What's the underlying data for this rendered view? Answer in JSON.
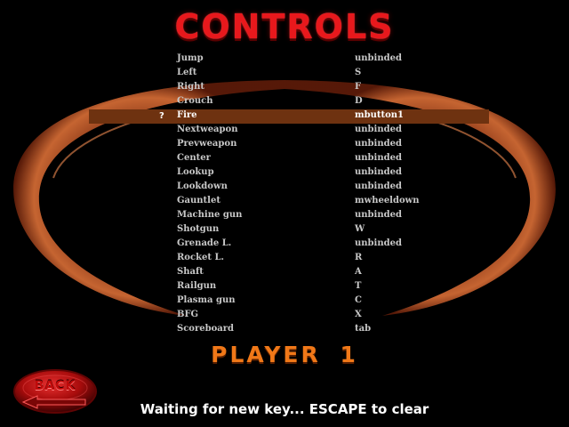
{
  "title": "CONTROLS",
  "bindings": [
    {
      "action": "Jump",
      "key": "unbinded"
    },
    {
      "action": "Left",
      "key": "S"
    },
    {
      "action": "Right",
      "key": "F"
    },
    {
      "action": "Crouch",
      "key": "D"
    },
    {
      "action": "Fire",
      "key": "mbutton1",
      "selected": true
    },
    {
      "action": "Nextweapon",
      "key": "unbinded"
    },
    {
      "action": "Prevweapon",
      "key": "unbinded"
    },
    {
      "action": "Center",
      "key": "unbinded"
    },
    {
      "action": "Lookup",
      "key": "unbinded"
    },
    {
      "action": "Lookdown",
      "key": "unbinded"
    },
    {
      "action": "Gauntlet",
      "key": "mwheeldown"
    },
    {
      "action": "Machine gun",
      "key": "unbinded"
    },
    {
      "action": "Shotgun",
      "key": "W"
    },
    {
      "action": "Grenade L.",
      "key": "unbinded"
    },
    {
      "action": "Rocket L.",
      "key": "R"
    },
    {
      "action": "Shaft",
      "key": "A"
    },
    {
      "action": "Railgun",
      "key": "T"
    },
    {
      "action": "Plasma gun",
      "key": "C"
    },
    {
      "action": "BFG",
      "key": "X"
    },
    {
      "action": "Scoreboard",
      "key": "tab"
    }
  ],
  "selection_marker": "?",
  "player_label": "PLAYER 1",
  "back_label": "BACK",
  "status_text": "Waiting for new key... ESCAPE to clear",
  "colors": {
    "title": "#e8181c",
    "player_label": "#f07818",
    "highlight": "#6e3210",
    "ring": "#b04a20",
    "text": "#c8c8c8",
    "back_button": "#a80c0c"
  }
}
